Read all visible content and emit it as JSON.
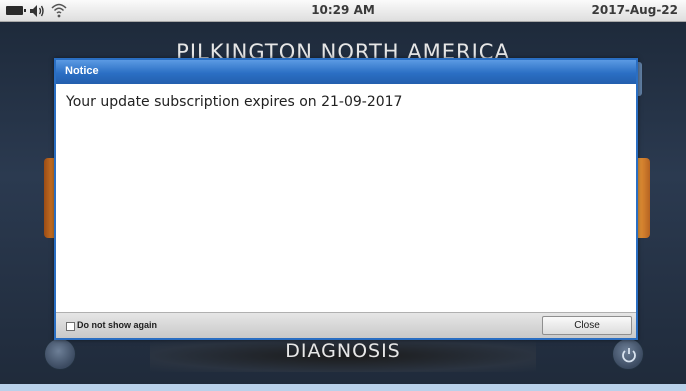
{
  "status_bar": {
    "time": "10:29 AM",
    "date": "2017-Aug-22",
    "icons": [
      "battery-icon",
      "speaker-icon",
      "wifi-icon"
    ]
  },
  "background": {
    "title": "PILKINGTON NORTH AMERICA",
    "bottom_label": "DIAGNOSIS",
    "icons": [
      "power-icon"
    ]
  },
  "dialog": {
    "title": "Notice",
    "message": "Your update subscription expires on 21-09-2017",
    "checkbox_label": "Do not show again",
    "checkbox_checked": false,
    "close_label": "Close"
  },
  "colors": {
    "header_blue": "#2b6fc4",
    "accent_orange": "#e78b2d",
    "background_dark": "#2b3a50"
  }
}
